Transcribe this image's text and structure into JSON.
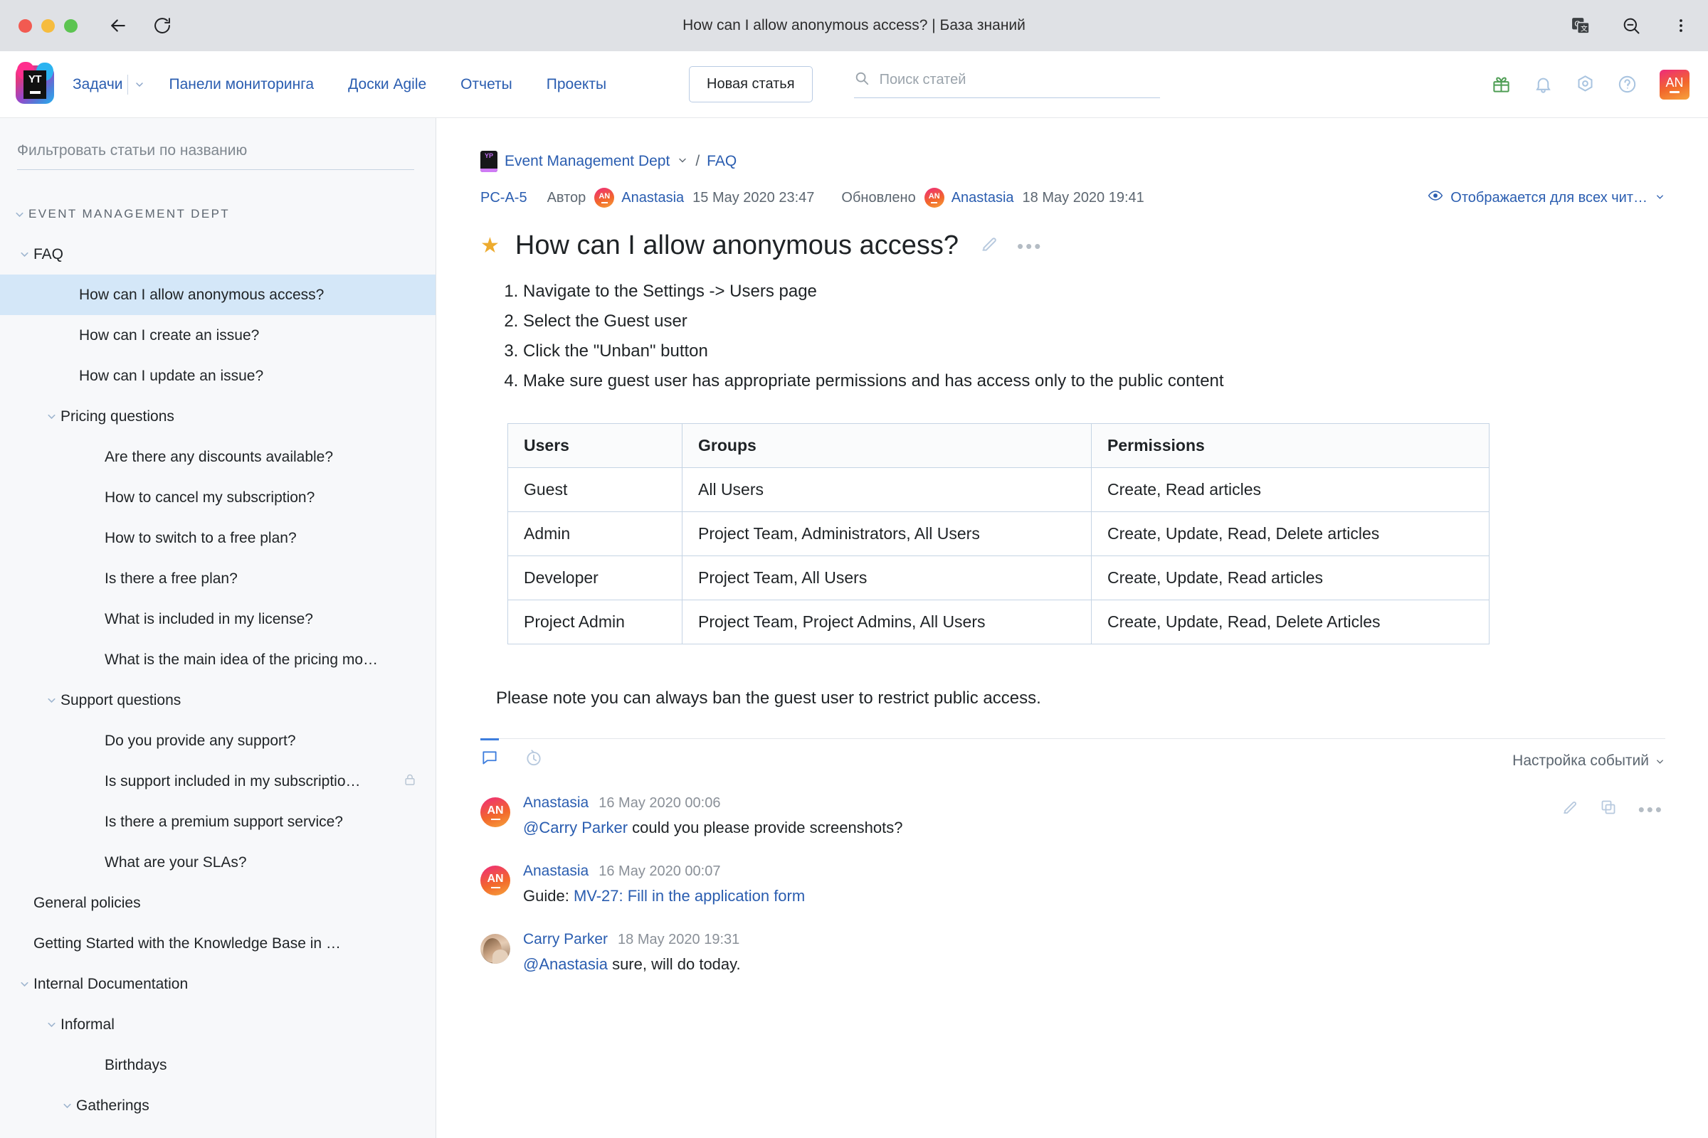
{
  "browser": {
    "tab_title": "How can I allow anonymous access? | База знаний",
    "back_icon": "back-arrow-icon",
    "reload_icon": "reload-icon",
    "translate_icon": "translate-icon",
    "zoom_out_icon": "zoom-out-icon",
    "menu_icon": "kebab-menu-icon"
  },
  "header": {
    "logo": "youtrack-logo",
    "nav": [
      {
        "label": "Задачи",
        "has_caret": true
      },
      {
        "label": "Панели мониторинга",
        "has_caret": false
      },
      {
        "label": "Доски Agile",
        "has_caret": false
      },
      {
        "label": "Отчеты",
        "has_caret": false
      },
      {
        "label": "Проекты",
        "has_caret": false
      }
    ],
    "new_article_label": "Новая статья",
    "search_placeholder": "Поиск статей",
    "search_value": "",
    "icons": [
      "gift-icon",
      "bell-icon",
      "settings-gear-icon",
      "help-question-icon"
    ],
    "avatar_initials": "AN"
  },
  "sidebar": {
    "filter_placeholder": "Фильтровать статьи по названию",
    "filter_value": "",
    "items": [
      {
        "label": "EVENT MANAGEMENT DEPT",
        "level": 0,
        "caret": "down",
        "section": true,
        "selected": false,
        "lock": false
      },
      {
        "label": "FAQ",
        "level": 1,
        "caret": "down",
        "section": false,
        "selected": false,
        "lock": false
      },
      {
        "label": "How can I allow anonymous access?",
        "level": 2,
        "caret": "none",
        "section": false,
        "selected": true,
        "lock": false
      },
      {
        "label": "How can I create an issue?",
        "level": 2,
        "caret": "none",
        "section": false,
        "selected": false,
        "lock": false
      },
      {
        "label": "How can I update an issue?",
        "level": 2,
        "caret": "none",
        "section": false,
        "selected": false,
        "lock": false
      },
      {
        "label": "Pricing questions",
        "level": 2,
        "caret": "down",
        "section": false,
        "selected": false,
        "lock": false
      },
      {
        "label": "Are there any discounts available?",
        "level": 3,
        "caret": "none",
        "section": false,
        "selected": false,
        "lock": false
      },
      {
        "label": "How to cancel my subscription?",
        "level": 3,
        "caret": "none",
        "section": false,
        "selected": false,
        "lock": false
      },
      {
        "label": "How to switch to a free plan?",
        "level": 3,
        "caret": "none",
        "section": false,
        "selected": false,
        "lock": false
      },
      {
        "label": "Is there a free plan?",
        "level": 3,
        "caret": "none",
        "section": false,
        "selected": false,
        "lock": false
      },
      {
        "label": "What is included in my license?",
        "level": 3,
        "caret": "none",
        "section": false,
        "selected": false,
        "lock": false
      },
      {
        "label": "What is the main idea of the pricing mo…",
        "level": 3,
        "caret": "none",
        "section": false,
        "selected": false,
        "lock": false
      },
      {
        "label": "Support questions",
        "level": 2,
        "caret": "down",
        "section": false,
        "selected": false,
        "lock": false
      },
      {
        "label": "Do you provide any support?",
        "level": 3,
        "caret": "none",
        "section": false,
        "selected": false,
        "lock": false
      },
      {
        "label": "Is support included in my subscriptio…",
        "level": 3,
        "caret": "none",
        "section": false,
        "selected": false,
        "lock": true
      },
      {
        "label": "Is there a premium support service?",
        "level": 3,
        "caret": "none",
        "section": false,
        "selected": false,
        "lock": false
      },
      {
        "label": "What are your SLAs?",
        "level": 3,
        "caret": "none",
        "section": false,
        "selected": false,
        "lock": false
      },
      {
        "label": "General policies",
        "level": 1,
        "caret": "none",
        "section": false,
        "selected": false,
        "lock": false
      },
      {
        "label": "Getting Started with the Knowledge Base in …",
        "level": 1,
        "caret": "none",
        "section": false,
        "selected": false,
        "lock": false
      },
      {
        "label": "Internal Documentation",
        "level": 1,
        "caret": "down",
        "section": false,
        "selected": false,
        "lock": false
      },
      {
        "label": "Informal",
        "level": 2,
        "caret": "down",
        "section": false,
        "selected": false,
        "lock": false
      },
      {
        "label": "Birthdays",
        "level": 3,
        "caret": "none",
        "section": false,
        "selected": false,
        "lock": false
      },
      {
        "label": "Gatherings",
        "level": 3,
        "caret": "down",
        "section": false,
        "selected": false,
        "lock": false
      }
    ]
  },
  "article": {
    "breadcrumb": {
      "project_icon_text": "YP",
      "project": "Event Management Dept",
      "separator": "/",
      "folder": "FAQ"
    },
    "meta": {
      "id": "PC-A-5",
      "author_label": "Автор",
      "author_initials": "AN",
      "author_name": "Anastasia",
      "created": "15 May 2020 23:47",
      "updated_label": "Обновлено",
      "updater_initials": "AN",
      "updater_name": "Anastasia",
      "updated": "18 May 2020 19:41",
      "visibility": "Отображается для всех чит…"
    },
    "title": "How can I allow anonymous access?",
    "star_icon": "star-filled-icon",
    "edit_icon": "pencil-icon",
    "more_icon": "more-horizontal-icon",
    "steps": [
      "Navigate to the Settings -> Users page",
      "Select the Guest user",
      "Click the \"Unban\" button",
      "Make sure guest user has appropriate permissions and has access only to the public content"
    ],
    "table": {
      "headers": [
        "Users",
        "Groups",
        "Permissions"
      ],
      "rows": [
        [
          "Guest",
          "All Users",
          "Create, Read articles"
        ],
        [
          "Admin",
          "Project Team, Administrators, All Users",
          "Create, Update, Read, Delete articles"
        ],
        [
          "Developer",
          "Project Team, All Users",
          "Create, Update, Read articles"
        ],
        [
          "Project Admin",
          "Project Team, Project Admins, All Users",
          "Create, Update, Read, Delete Articles"
        ]
      ]
    },
    "note": "Please note you can always ban the guest user to restrict public access."
  },
  "activity": {
    "tabs": [
      {
        "icon": "comment-bubble-icon",
        "active": true
      },
      {
        "icon": "history-clock-icon",
        "active": false
      }
    ],
    "settings_label": "Настройка событий",
    "comments": [
      {
        "avatar": "initials",
        "initials": "AN",
        "author": "Anastasia",
        "time": "16 May 2020 00:06",
        "mention": "@Carry Parker",
        "text": " could you please provide screenshots?",
        "link": "",
        "prefix": "",
        "actions": [
          "pencil-icon",
          "copy-icon",
          "more-horizontal-icon"
        ]
      },
      {
        "avatar": "initials",
        "initials": "AN",
        "author": "Anastasia",
        "time": "16 May 2020 00:07",
        "mention": "",
        "prefix": "Guide: ",
        "link": "MV-27: Fill in the application form",
        "text": "",
        "actions": []
      },
      {
        "avatar": "photo",
        "initials": "",
        "author": "Carry Parker",
        "time": "18 May 2020 19:31",
        "mention": "@Anastasia",
        "text": " sure, will do today.",
        "link": "",
        "prefix": "",
        "actions": []
      }
    ]
  },
  "colors": {
    "link": "#2a5db0",
    "selected_row": "#d4e7f8",
    "sidebar_bg": "#f7f8fa",
    "chrome_bg": "#dfe1e5",
    "star": "#edab2e"
  }
}
